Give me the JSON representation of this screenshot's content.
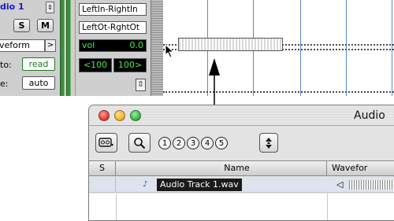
{
  "track": {
    "name": "dio 1",
    "solo_label": "S",
    "mute_label": "M",
    "view_selector": "veform",
    "view_arrow": ">",
    "automation_prefix": "to:",
    "automation_mode": "read",
    "voice_prefix": "e:",
    "voice_mode": "auto"
  },
  "io": {
    "input": "LeftIn-RightIn",
    "output": "LeftOt-RghtOt",
    "vol_label": "vol",
    "vol_value": "0.0",
    "pan_left": "<100",
    "pan_right": "100>",
    "dir_symbol": "⇳"
  },
  "regions_window": {
    "title": "Audio",
    "toolbar_numbers": [
      "1",
      "2",
      "3",
      "4",
      "5"
    ],
    "columns": {
      "s": "S",
      "name": "Name",
      "waveform": "Wavefor"
    },
    "rows": [
      {
        "name": "Audio Track 1.wav"
      }
    ]
  },
  "colors": {
    "track_name": "#1a1acc",
    "meter_green": "#3e8a3e",
    "lcd_green": "#44ee44",
    "grid_blue": "#5a88c8",
    "close_red": "#e0453a",
    "minimize_yellow": "#f3b431",
    "zoom_green": "#3dbd47"
  },
  "icons": [
    "menu-arrow-icon",
    "pointer-icon",
    "drag-arrow-icon",
    "tape-icon",
    "magnifier-icon",
    "updown-icon",
    "region-icon",
    "speaker-icon"
  ]
}
